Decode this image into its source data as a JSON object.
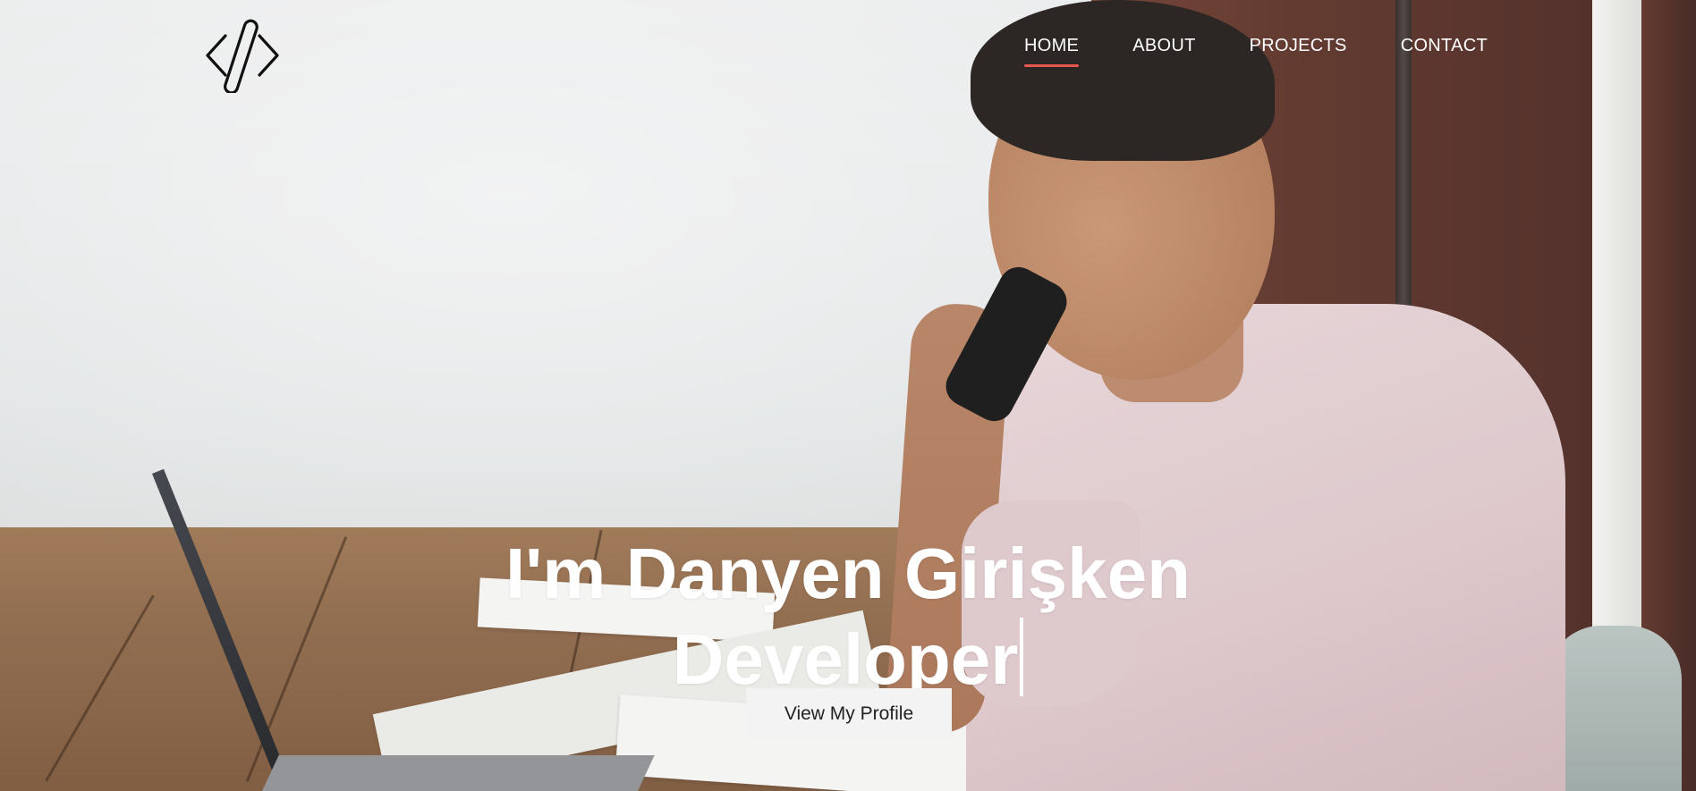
{
  "brand": {
    "logo_icon": "code-brackets-icon"
  },
  "nav": {
    "items": [
      {
        "label": "HOME",
        "active": true
      },
      {
        "label": "ABOUT",
        "active": false
      },
      {
        "label": "PROJECTS",
        "active": false
      },
      {
        "label": "CONTACT",
        "active": false
      }
    ],
    "active_underline_color": "#e8574f"
  },
  "hero": {
    "title_line1": "I'm Danyen Girişken",
    "title_line2": "Developer",
    "cta_label": "View My Profile"
  }
}
